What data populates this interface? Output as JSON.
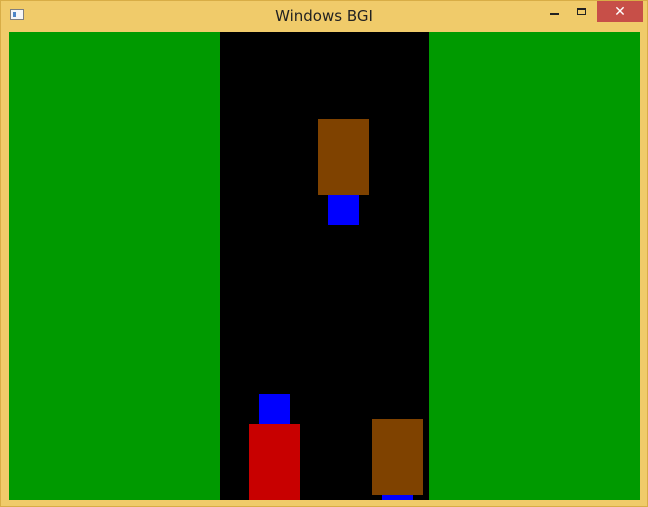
{
  "window": {
    "title": "Windows BGI",
    "close_glyph": "✕"
  },
  "colors": {
    "grass": "#009a00",
    "road": "#000000",
    "enemy_body": "#7f4200",
    "enemy_head": "#0000ff",
    "player_body": "#c80000",
    "player_head": "#0000ff",
    "titlebar": "#f0cb6a",
    "close_button": "#c74f48"
  },
  "scene": {
    "enemy_cars": 2,
    "player_cars": 1
  }
}
